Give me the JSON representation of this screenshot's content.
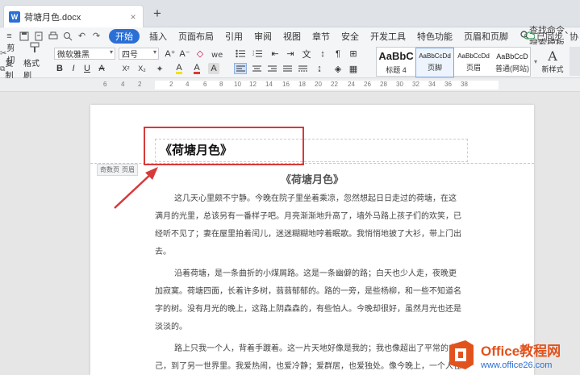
{
  "tabbar": {
    "doc_tab_label": "荷塘月色.docx",
    "doc_icon": "W",
    "close_icon": "×",
    "new_tab": "+"
  },
  "menubar": {
    "items": [
      "开始",
      "插入",
      "页面布局",
      "引用",
      "审阅",
      "视图",
      "章节",
      "安全",
      "开发工具",
      "特色功能",
      "页眉和页脚"
    ],
    "active_index": 0,
    "search_label": "查找命令、搜索模板",
    "sync_label": "已同步",
    "share_label": "协"
  },
  "ribbon": {
    "cut": "剪切",
    "format_painter": "格式刷",
    "copy": "复制",
    "paste": "粘贴",
    "font_name": "微软雅黑",
    "font_size": "四号",
    "bold": "B",
    "italic": "I",
    "underline": "U",
    "strike": "A",
    "superscript": "X²",
    "subscript": "X₂",
    "grow_font": "A⁺",
    "shrink_font": "A⁻",
    "clear_format": "◇",
    "font_color": "A",
    "highlight_color": "A",
    "styles": [
      {
        "sample": "AaBbC",
        "label": "标题 4"
      },
      {
        "sample": "AaBbCcDd",
        "label": "页脚"
      },
      {
        "sample": "AaBbCcDd",
        "label": "页眉"
      },
      {
        "sample": "AaBbCcD",
        "label": "普通(网站)"
      }
    ],
    "selected_style_index": 1,
    "new_style": "新样式"
  },
  "ruler": {
    "numbers": [
      "6",
      "4",
      "2",
      "2",
      "4",
      "6",
      "8",
      "10",
      "12",
      "14",
      "16",
      "18",
      "20",
      "22",
      "24",
      "26",
      "28",
      "30",
      "32",
      "34",
      "36",
      "38"
    ]
  },
  "document": {
    "header_text": "《荷塘月色》",
    "header_tag": [
      "奇数页",
      "页眉"
    ],
    "title": "《荷塘月色》",
    "paragraphs": [
      "这几天心里颇不宁静。今晚在院子里坐着乘凉，忽然想起日日走过的荷塘，在这满月的光里，总该另有一番样子吧。月亮渐渐地升高了，墙外马路上孩子们的欢笑，已经听不见了；妻在屋里拍着闰儿，迷迷糊糊地哼着眠歌。我悄悄地披了大衫，带上门出去。",
      "沿着荷塘，是一条曲折的小煤屑路。这是一条幽僻的路；白天也少人走，夜晚更加寂寞。荷塘四面，长着许多树，蓊蓊郁郁的。路的一旁，是些杨柳，和一些不知道名字的树。没有月光的晚上，这路上阴森森的，有些怕人。今晚却很好，虽然月光也还是淡淡的。",
      "路上只我一个人，背着手踱着。这一片天地好像是我的；我也像超出了平常的自己，到了另一世界里。我爱热闹，也爱冷静；爱群居，也爱独处。像今晚上，一个人在这苍茫的月下，什么都可以想，什么都可以不想，便觉是个自由的人。"
    ]
  },
  "watermark": {
    "line1": "Office教程网",
    "line2": "www.office26.com"
  },
  "colors": {
    "accent": "#2b6fd6",
    "highlight_border": "#d83a3a",
    "watermark_orange": "#e2521d"
  }
}
